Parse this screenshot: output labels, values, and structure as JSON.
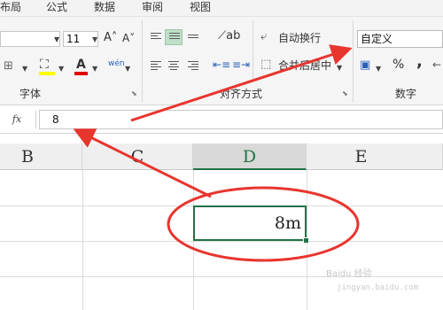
{
  "tabs": [
    "布局",
    "公式",
    "数据",
    "审阅",
    "视图"
  ],
  "font_group": {
    "label": "字体",
    "size": "11",
    "grow_icon": "A˄",
    "shrink_icon": "A˅",
    "font_color_letter": "A",
    "phonetic_icon": "wén"
  },
  "align_group": {
    "label": "对齐方式",
    "wrap_text": "自动换行",
    "merge_center": "合并后居中"
  },
  "number_group": {
    "label": "数字",
    "format": "自定义",
    "percent": "%",
    "comma": ","
  },
  "formula_bar": {
    "fx": "fx",
    "value": "8"
  },
  "columns": [
    "B",
    "C",
    "D",
    "E"
  ],
  "cell_value": "8m",
  "watermark": "Baidu 经验",
  "watermark_url": "jingyan.baidu.com",
  "colors": {
    "accent_green": "#217346",
    "annotation_red": "#e8352e"
  }
}
